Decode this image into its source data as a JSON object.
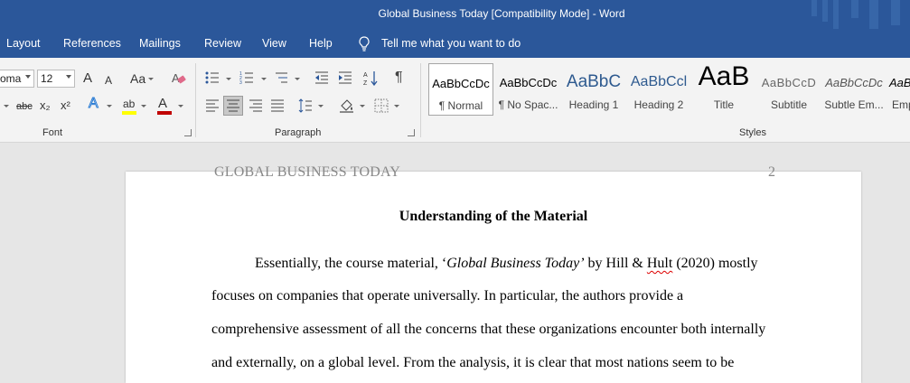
{
  "window": {
    "title": "Global Business Today [Compatibility Mode]  -  Word"
  },
  "menu": {
    "items": [
      "Layout",
      "References",
      "Mailings",
      "Review",
      "View",
      "Help"
    ],
    "tell_me": "Tell me what you want to do"
  },
  "font_group": {
    "font_name": "oma",
    "font_size": "12",
    "grow": "A",
    "shrink": "A",
    "case": "Aa",
    "strike": "abc",
    "subscript": "x₂",
    "superscript": "x²",
    "text_effects": "A",
    "highlight": "ab",
    "font_color": "A",
    "label": "Font"
  },
  "paragraph_group": {
    "label": "Paragraph",
    "pilcrow": "¶"
  },
  "styles_group": {
    "label": "Styles",
    "items": [
      {
        "sample": "AaBbCcDc",
        "name": "¶ Normal"
      },
      {
        "sample": "AaBbCcDc",
        "name": "¶ No Spac..."
      },
      {
        "sample": "AaBbC",
        "name": "Heading 1"
      },
      {
        "sample": "AaBbCcl",
        "name": "Heading 2"
      },
      {
        "sample": "AaB",
        "name": "Title"
      },
      {
        "sample": "AaBbCcD",
        "name": "Subtitle"
      },
      {
        "sample": "AaBbCcDc",
        "name": "Subtle Em..."
      },
      {
        "sample": "AaBbCcDc",
        "name": "Emp"
      }
    ]
  },
  "colors": {
    "accent": "#2b579a",
    "highlight": "#ffff00",
    "font_color": "#c00000"
  },
  "document": {
    "header": "GLOBAL BUSINESS TODAY",
    "page_number": "2",
    "heading": "Understanding of the Material",
    "p1_pre": "Essentially, the course material, ‘",
    "p1_title": "Global Business Today’",
    "p1_by": " by Hill & ",
    "p1_hult": "Hult",
    "p1_post": " (2020) mostly",
    "line2": "focuses on companies that operate universally. In particular, the authors provide a",
    "line3": "comprehensive assessment of all the concerns that these organizations encounter both internally",
    "line4": "and externally, on a global level. From the analysis, it is clear that most nations seem to be"
  }
}
